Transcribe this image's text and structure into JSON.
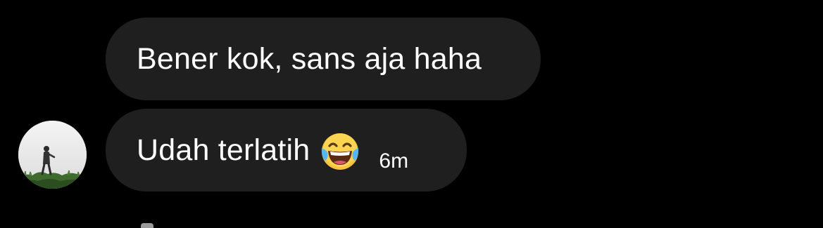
{
  "conversation": {
    "messages": [
      {
        "text": "Bener kok, sans aja haha"
      },
      {
        "text": "Udah terlatih",
        "emoji": "face-with-tears-of-joy",
        "time": "6m"
      }
    ]
  },
  "colors": {
    "background": "#000000",
    "bubble": "#1f1f1f",
    "text": "#ffffff"
  }
}
